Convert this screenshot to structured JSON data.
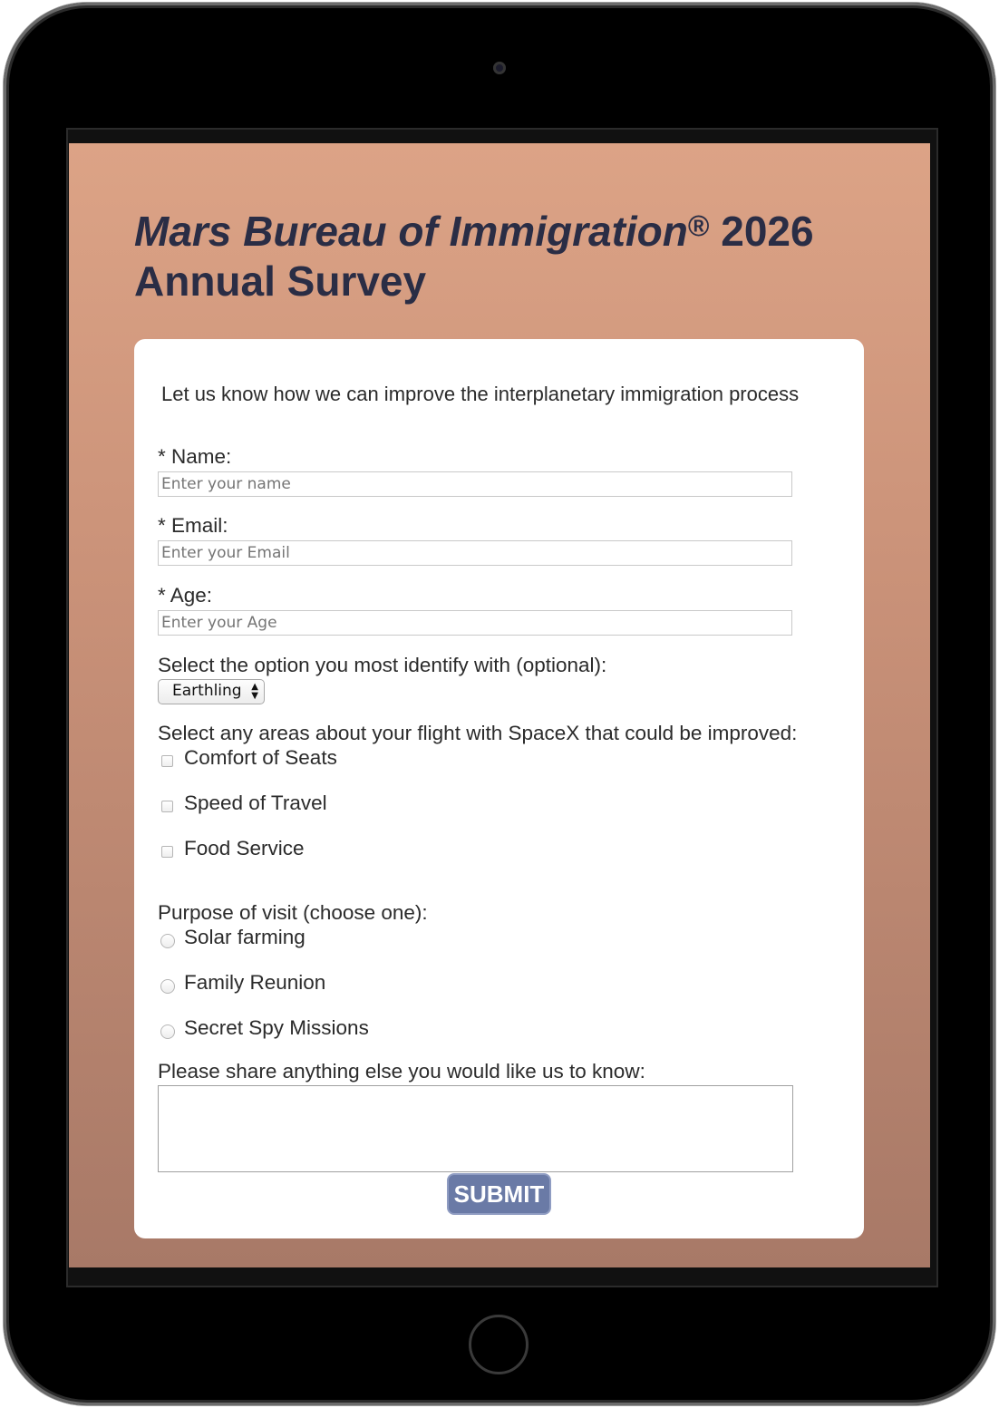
{
  "page": {
    "title_italic": "Mars Bureau of Immigration",
    "title_registered": "®",
    "title_rest": " 2026 Annual Survey",
    "intro": "Let us know how we can improve the interplanetary immigration process"
  },
  "form": {
    "name": {
      "label": "* Name:",
      "placeholder": "Enter your name"
    },
    "email": {
      "label": "* Email:",
      "placeholder": "Enter your Email"
    },
    "age": {
      "label": "* Age:",
      "placeholder": "Enter your Age"
    },
    "identify": {
      "label": "Select the option you most identify with (optional):",
      "selected": "Earthling"
    },
    "improvements": {
      "label": "Select any areas about your flight with SpaceX that could be improved:",
      "options": [
        "Comfort of Seats",
        "Speed of Travel",
        "Food Service"
      ]
    },
    "purpose": {
      "label": "Purpose of visit (choose one):",
      "options": [
        "Solar farming",
        "Family Reunion",
        "Secret Spy Missions"
      ]
    },
    "comments": {
      "label": "Please share anything else you would like us to know:",
      "value": ""
    },
    "submit_label": "SUBMIT"
  },
  "colors": {
    "title_text": "#2a2d45",
    "background_top": "#dca386",
    "background_bottom": "#a87967",
    "submit_bg": "#6a7aa6"
  }
}
